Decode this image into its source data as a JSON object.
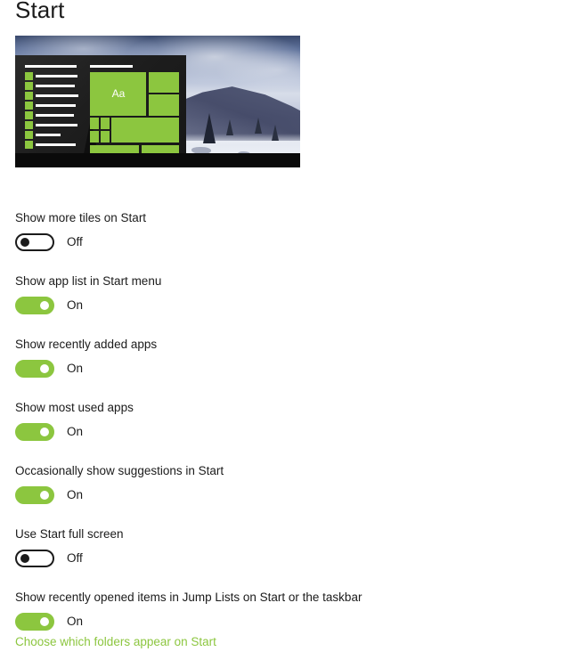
{
  "page": {
    "title": "Start"
  },
  "preview": {
    "name": "start-menu-preview",
    "tile_label": "Aa",
    "app_rows": 8,
    "alt": "Start menu preview with green tiles over a snowy mountain wallpaper"
  },
  "settings": [
    {
      "id": "show-more-tiles",
      "label": "Show more tiles on Start",
      "state": "Off",
      "on": false
    },
    {
      "id": "show-app-list",
      "label": "Show app list in Start menu",
      "state": "On",
      "on": true
    },
    {
      "id": "show-recently-added-apps",
      "label": "Show recently added apps",
      "state": "On",
      "on": true
    },
    {
      "id": "show-most-used-apps",
      "label": "Show most used apps",
      "state": "On",
      "on": true
    },
    {
      "id": "show-suggestions",
      "label": "Occasionally show suggestions in Start",
      "state": "On",
      "on": true
    },
    {
      "id": "use-start-full-screen",
      "label": "Use Start full screen",
      "state": "Off",
      "on": false
    },
    {
      "id": "show-jump-lists",
      "label": "Show recently opened items in Jump Lists on Start or the taskbar",
      "state": "On",
      "on": true
    }
  ],
  "footer": {
    "link_label": "Choose which folders appear on Start"
  },
  "colors": {
    "accent_green": "#8cc63f",
    "text": "#1b1b1b",
    "background": "#ffffff"
  }
}
